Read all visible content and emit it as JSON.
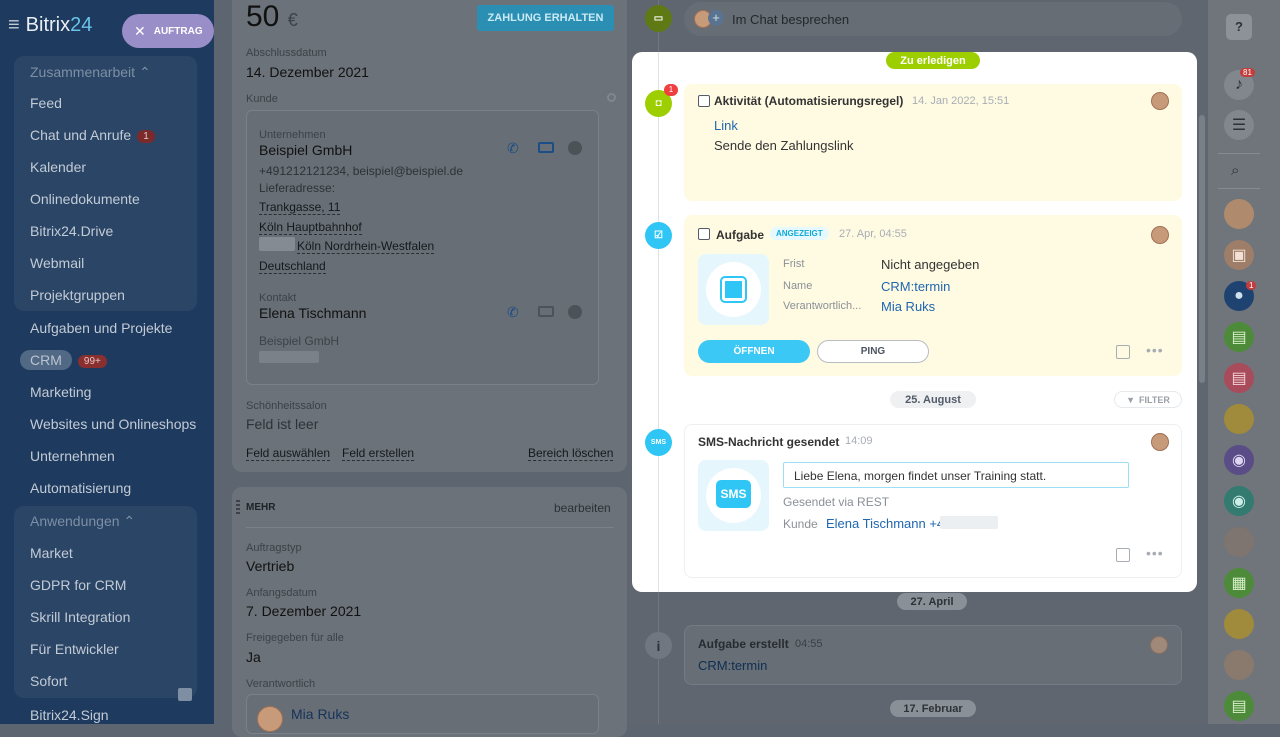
{
  "sidebar": {
    "logo_main": "Bitrix",
    "logo_num": "24",
    "menu_icon": "≡",
    "auftrag_label": "AUFTRAG",
    "group1": "Zusammenarbeit",
    "items1": [
      "Feed",
      "Chat und Anrufe",
      "Kalender",
      "Onlinedokumente",
      "Bitrix24.Drive",
      "Webmail",
      "Projektgruppen"
    ],
    "chat_badge": "1",
    "items_mid": [
      "Aufgaben und Projekte",
      "CRM",
      "Marketing",
      "Websites und Onlineshops",
      "Unternehmen",
      "Automatisierung"
    ],
    "crm_badge": "99+",
    "group2": "Anwendungen",
    "items2": [
      "Market",
      "GDPR for CRM",
      "Skrill Integration",
      "Für Entwickler",
      "Sofort",
      "Bitrix24.Sign"
    ]
  },
  "deal": {
    "amount": "50",
    "currency": "€",
    "pay_button": "ZAHLUNG ERHALTEN",
    "close_date_label": "Abschlussdatum",
    "close_date": "14. Dezember 2021",
    "client_label": "Kunde",
    "company_label": "Unternehmen",
    "company": "Beispiel GmbH",
    "company_contact": "+491212121234, beispiel@beispiel.de",
    "delivery_label": "Lieferadresse:",
    "addr1": "Trankgasse, 11",
    "addr2": "Köln Hauptbahnhof",
    "addr3": "Köln Nordrhein-Westfalen",
    "addr4": "Deutschland",
    "contact_label": "Kontakt",
    "contact": "Elena Tischmann",
    "contact_company": "Beispiel GmbH",
    "salon_label": "Schönheitssalon",
    "salon_value": "Feld ist leer",
    "select_field": "Feld auswählen",
    "create_field": "Feld erstellen",
    "delete_area": "Bereich löschen",
    "more_title": "MEHR",
    "edit": "bearbeiten",
    "type_label": "Auftragstyp",
    "type_value": "Vertrieb",
    "start_label": "Anfangsdatum",
    "start_value": "7. Dezember 2021",
    "shared_label": "Freigegeben für alle",
    "shared_value": "Ja",
    "resp_label": "Verantwortlich",
    "resp_value": "Mia Ruks"
  },
  "timeline": {
    "chat_prompt": "Im Chat besprechen",
    "todo_pill": "Zu erledigen",
    "activity": {
      "title": "Aktivität (Automatisierungsregel)",
      "time": "14. Jan 2022, 15:51",
      "link": "Link",
      "text": "Sende den Zahlungslink",
      "badge": "1"
    },
    "task": {
      "title": "Aufgabe",
      "status": "ANGEZEIGT",
      "time": "27. Apr, 04:55",
      "frist_label": "Frist",
      "frist_value": "Nicht angegeben",
      "name_label": "Name",
      "name_value": "CRM:termin",
      "resp_label": "Verantwortlich...",
      "resp_value": "Mia Ruks",
      "open_btn": "ÖFFNEN",
      "ping_btn": "PING"
    },
    "date1": "25. August",
    "filter": "FILTER",
    "sms": {
      "title": "SMS-Nachricht gesendet",
      "time": "14:09",
      "icon_text": "SMS",
      "message": "Liebe Elena, morgen findet unser Training statt.",
      "via": "Gesendet via REST",
      "client_label": "Kunde",
      "client_value": "Elena Tischmann +4"
    },
    "date2": "27. April",
    "created": {
      "title": "Aufgabe erstellt",
      "time": "04:55",
      "link": "CRM:termin"
    },
    "date3": "17. Februar"
  },
  "strip": {
    "help": "?",
    "bell_badge": "81",
    "group_badge": "1"
  },
  "colors": {
    "accent": "#3bc8f5",
    "todo_green": "#9dcf00",
    "yellow_card": "#fffbe3",
    "link": "#2067b0"
  }
}
